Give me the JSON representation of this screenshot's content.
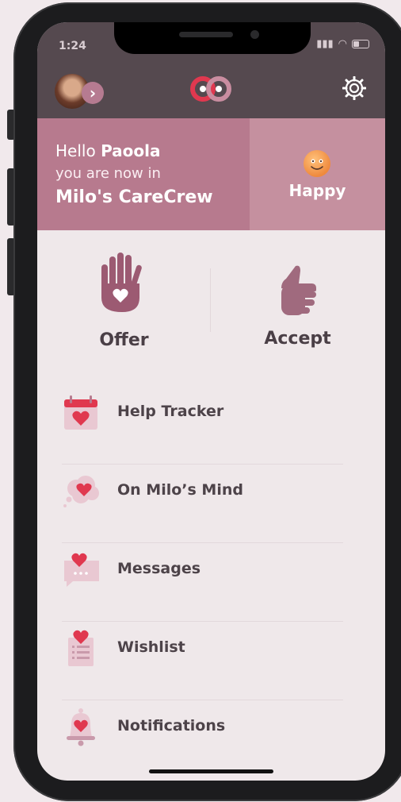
{
  "status": {
    "time": "1:24",
    "signal": "ılıl",
    "wifi": "wifi"
  },
  "header": {
    "avatar_icon": "avatar",
    "logo": "milo-care-logo",
    "settings_icon": "gear-icon"
  },
  "banner": {
    "hello": "Hello",
    "name": "Paoola",
    "line2": "you are now in",
    "crew": "Milo's CareCrew",
    "mood": "Happy",
    "colors": {
      "left": "#b77a8e",
      "right": "#c5909f",
      "header": "#55494f"
    }
  },
  "actions": [
    {
      "label": "Offer",
      "icon": "open-hand-heart-icon"
    },
    {
      "label": "Accept",
      "icon": "thumbs-up-hand-icon"
    }
  ],
  "menu": [
    {
      "label": "Help Tracker",
      "icon": "calendar-heart-icon"
    },
    {
      "label": "On Milo’s Mind",
      "icon": "thought-cloud-heart-icon"
    },
    {
      "label": "Messages",
      "icon": "message-heart-icon"
    },
    {
      "label": "Wishlist",
      "icon": "list-heart-icon"
    },
    {
      "label": "Notifications",
      "icon": "bell-heart-icon"
    }
  ],
  "accent": "#e0384f"
}
